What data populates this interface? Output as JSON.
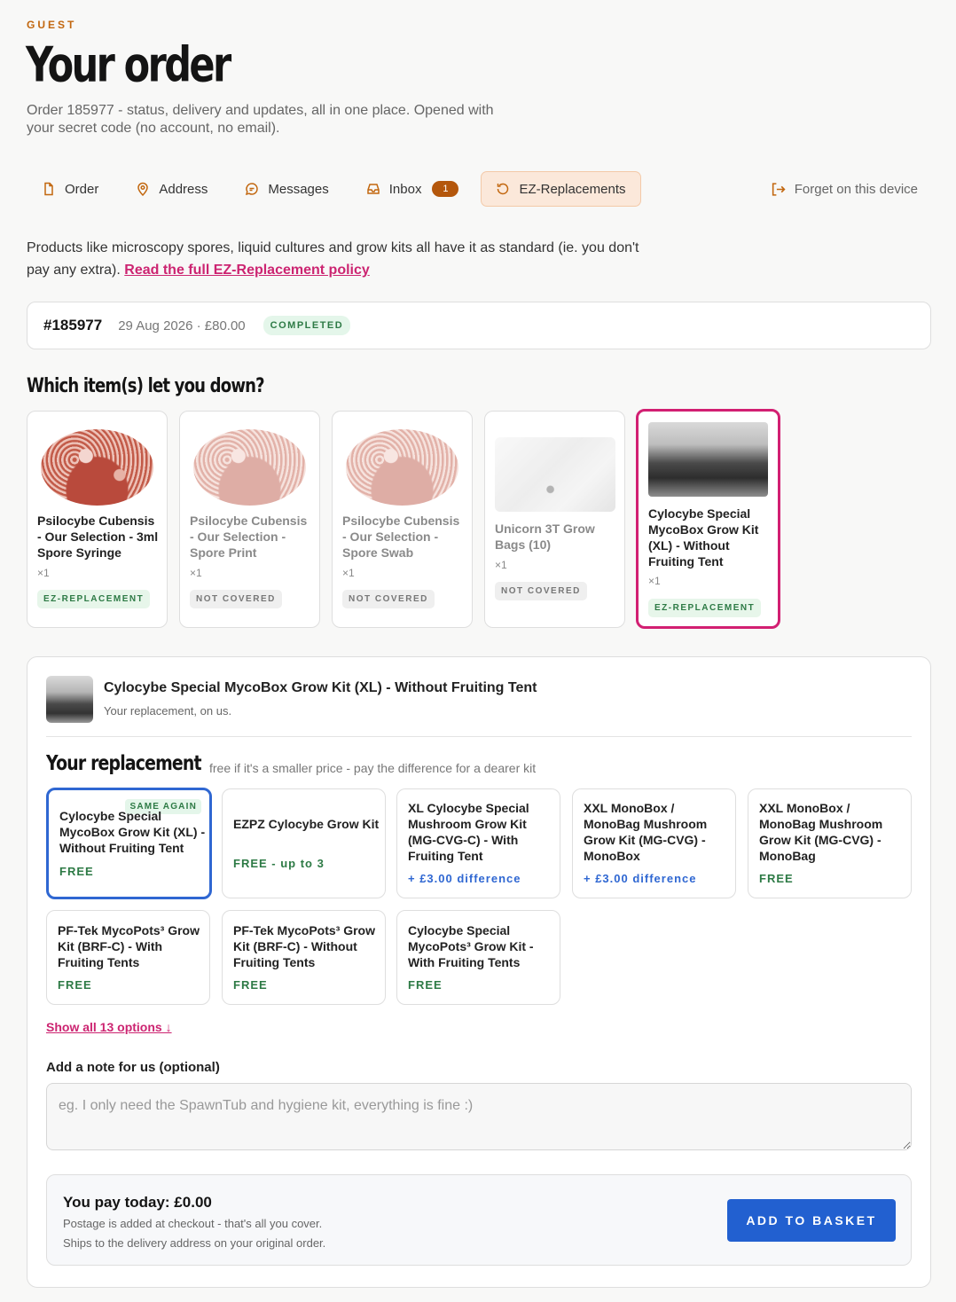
{
  "header": {
    "eyebrow": "GUEST",
    "title": "Your order",
    "subtitle": "Order 185977 - status, delivery and updates, all in one place. Opened with your secret code (no account, no email)."
  },
  "tabs": [
    {
      "label": "Order",
      "icon": "document-icon"
    },
    {
      "label": "Address",
      "icon": "map-pin-icon"
    },
    {
      "label": "Messages",
      "icon": "chat-bubble-icon"
    },
    {
      "label": "Inbox",
      "icon": "inbox-icon",
      "count": "1"
    },
    {
      "label": "EZ-Replacements",
      "icon": "refresh-icon",
      "active": true
    }
  ],
  "forget_label": "Forget on this device",
  "intro": {
    "text": "Products like microscopy spores, liquid cultures and grow kits all have it as standard (ie. you don't pay any extra). ",
    "link": "Read the full EZ-Replacement policy"
  },
  "order": {
    "number": "#185977",
    "meta": "29 Aug 2026 · £80.00",
    "status": "COMPLETED"
  },
  "items_title": "Which item(s) let you down?",
  "items": [
    {
      "name": "Psilocybe Cubensis - Our Selection - 3ml Spore Syringe",
      "qty": "×1",
      "coverage": "EZ-REPLACEMENT"
    },
    {
      "name": "Psilocybe Cubensis - Our Selection - Spore Print",
      "qty": "×1",
      "coverage": "NOT COVERED"
    },
    {
      "name": "Psilocybe Cubensis - Our Selection - Spore Swab",
      "qty": "×1",
      "coverage": "NOT COVERED"
    },
    {
      "name": "Unicorn 3T Grow Bags (10)",
      "qty": "×1",
      "coverage": "NOT COVERED"
    },
    {
      "name": "Cylocybe Special MycoBox Grow Kit (XL) - Without Fruiting Tent",
      "qty": "×1",
      "coverage": "EZ-REPLACEMENT",
      "selected": true
    }
  ],
  "panel": {
    "title": "Cylocybe Special MycoBox Grow Kit (XL) - Without Fruiting Tent",
    "subtitle": "Your replacement, on us.",
    "replacement_title": "Your replacement",
    "replacement_hint": "free if it's a smaller price - pay the difference for a dearer kit",
    "same_again": "SAME AGAIN",
    "options": [
      {
        "name": "Cylocybe Special MycoBox Grow Kit (XL) - Without Fruiting Tent",
        "price": "FREE"
      },
      {
        "name": "EZPZ Cylocybe Grow Kit",
        "price": "FREE - up to 3"
      },
      {
        "name": "XL Cylocybe Special Mushroom Grow Kit (MG-CVG-C) - With Fruiting Tent",
        "price": "+ £3.00 difference"
      },
      {
        "name": "XXL MonoBox / MonoBag Mushroom Grow Kit (MG-CVG) - MonoBox",
        "price": "+ £3.00 difference"
      },
      {
        "name": "XXL MonoBox / MonoBag Mushroom Grow Kit (MG-CVG) - MonoBag",
        "price": "FREE"
      },
      {
        "name": "PF-Tek MycoPots³ Grow Kit (BRF-C) - With Fruiting Tents",
        "price": "FREE"
      },
      {
        "name": "PF-Tek MycoPots³ Grow Kit (BRF-C) - Without Fruiting Tents",
        "price": "FREE"
      },
      {
        "name": "Cylocybe Special MycoPots³ Grow Kit - With Fruiting Tents",
        "price": "FREE"
      }
    ],
    "show_all": "Show all 13 options ↓",
    "note_label": "Add a note for us (optional)",
    "note_placeholder": "eg. I only need the SpawnTub and hygiene kit, everything is fine :)",
    "pay_title": "You pay today: £0.00",
    "pay_line1": "Postage is added at checkout - that's all you cover.",
    "pay_line2": "Ships to the delivery address on your original order.",
    "button": "ADD TO BASKET"
  },
  "colors": {
    "accent_orange": "#c2670f",
    "accent_pink": "#d21f72",
    "accent_blue": "#2260d0",
    "free_green": "#2d7a45"
  }
}
